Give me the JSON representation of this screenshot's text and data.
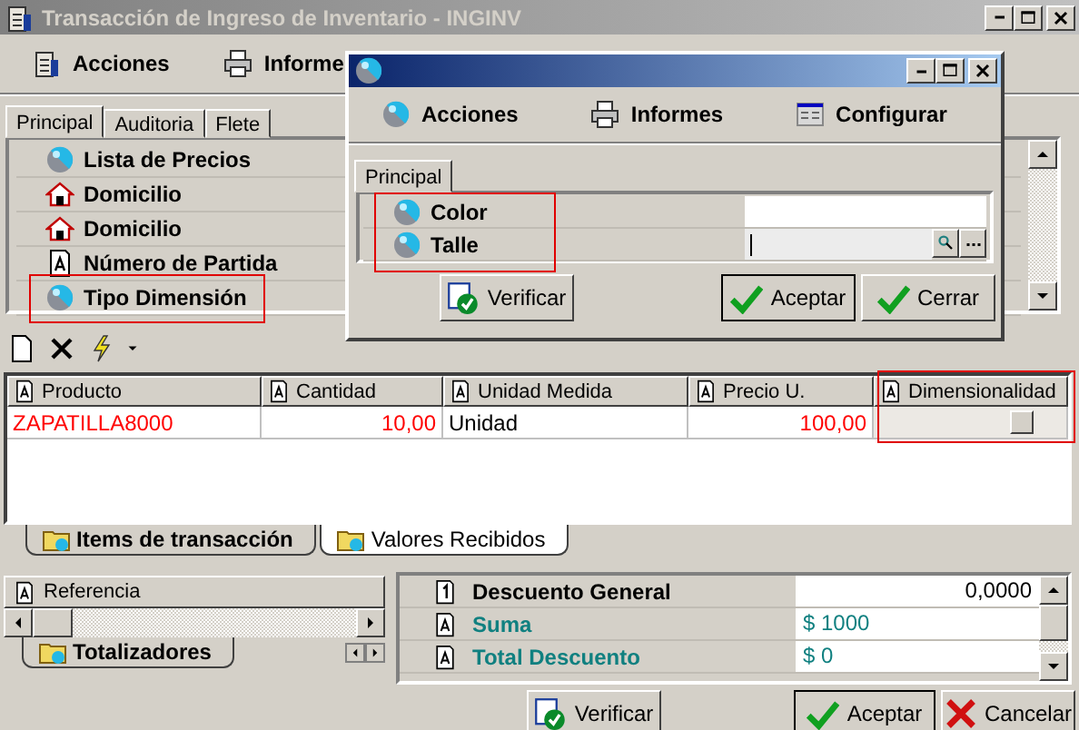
{
  "window": {
    "title": "Transacción de Ingreso de Inventario - INGINV",
    "active": false
  },
  "toolbar": [
    {
      "label": "Acciones",
      "kind": "actions"
    },
    {
      "label": "Informe",
      "kind": "reports"
    }
  ],
  "tabs": [
    {
      "label": "Principal",
      "selected": true
    },
    {
      "label": "Auditoria",
      "selected": false
    },
    {
      "label": "Flete",
      "selected": false
    }
  ],
  "properties": [
    {
      "label": "Lista de Precios",
      "kind": "lookup",
      "highlighted": false
    },
    {
      "label": "Domicilio",
      "kind": "address",
      "highlighted": false
    },
    {
      "label": "Domicilio",
      "kind": "address",
      "highlighted": false
    },
    {
      "label": "Número de Partida",
      "kind": "text",
      "highlighted": false
    },
    {
      "label": "Tipo Dimensión",
      "kind": "lookup",
      "highlighted": true
    }
  ],
  "grid": {
    "columns": [
      {
        "label": "Producto",
        "kind": "text",
        "highlighted": false
      },
      {
        "label": "Cantidad",
        "kind": "number",
        "highlighted": false
      },
      {
        "label": "Unidad Medida",
        "kind": "text",
        "highlighted": false
      },
      {
        "label": "Precio U.",
        "kind": "number",
        "highlighted": false
      },
      {
        "label": "Dimensionalidad",
        "kind": "check",
        "highlighted": true
      }
    ],
    "rows": [
      {
        "cells": [
          {
            "text": "ZAPATILLA8000",
            "color": "#ff0000"
          },
          {
            "text": "10,00",
            "color": "#ff0000"
          },
          {
            "text": "Unidad",
            "color": "#000000"
          },
          {
            "text": "100,00",
            "color": "#ff0000"
          }
        ],
        "checked": false
      }
    ]
  },
  "bottom_tabs": [
    {
      "label": "Items de transacción",
      "selected": true
    },
    {
      "label": "Valores Recibidos",
      "selected": false
    }
  ],
  "reference": {
    "header": "Referencia",
    "tab": "Totalizadores"
  },
  "totals": [
    {
      "label": "Descuento General",
      "value": "0,0000",
      "kind": "number"
    },
    {
      "label": "Suma",
      "value": "$ 1000",
      "kind": "amount"
    },
    {
      "label": "Total Descuento",
      "value": "$ 0",
      "kind": "amount"
    }
  ],
  "buttons": [
    {
      "label": "Verificar",
      "kind": "verify",
      "default": false
    },
    {
      "label": "Aceptar",
      "kind": "accept",
      "default": true
    },
    {
      "label": "Cancelar",
      "kind": "cancel",
      "default": false
    }
  ],
  "dialog": {
    "active": true,
    "toolbar": [
      {
        "label": "Acciones",
        "kind": "actions"
      },
      {
        "label": "Informes",
        "kind": "reports"
      },
      {
        "label": "Configurar",
        "kind": "configure"
      }
    ],
    "tabs": [
      {
        "label": "Principal",
        "selected": true
      }
    ],
    "labels_highlighted": true,
    "fields": [
      {
        "label": "Color",
        "focused": false
      },
      {
        "label": "Talle",
        "focused": true
      }
    ],
    "buttons": [
      {
        "label": "Verificar",
        "kind": "verify",
        "default": false
      },
      {
        "label": "Aceptar",
        "kind": "accept",
        "default": true
      },
      {
        "label": "Cerrar",
        "kind": "close",
        "default": false
      }
    ]
  }
}
